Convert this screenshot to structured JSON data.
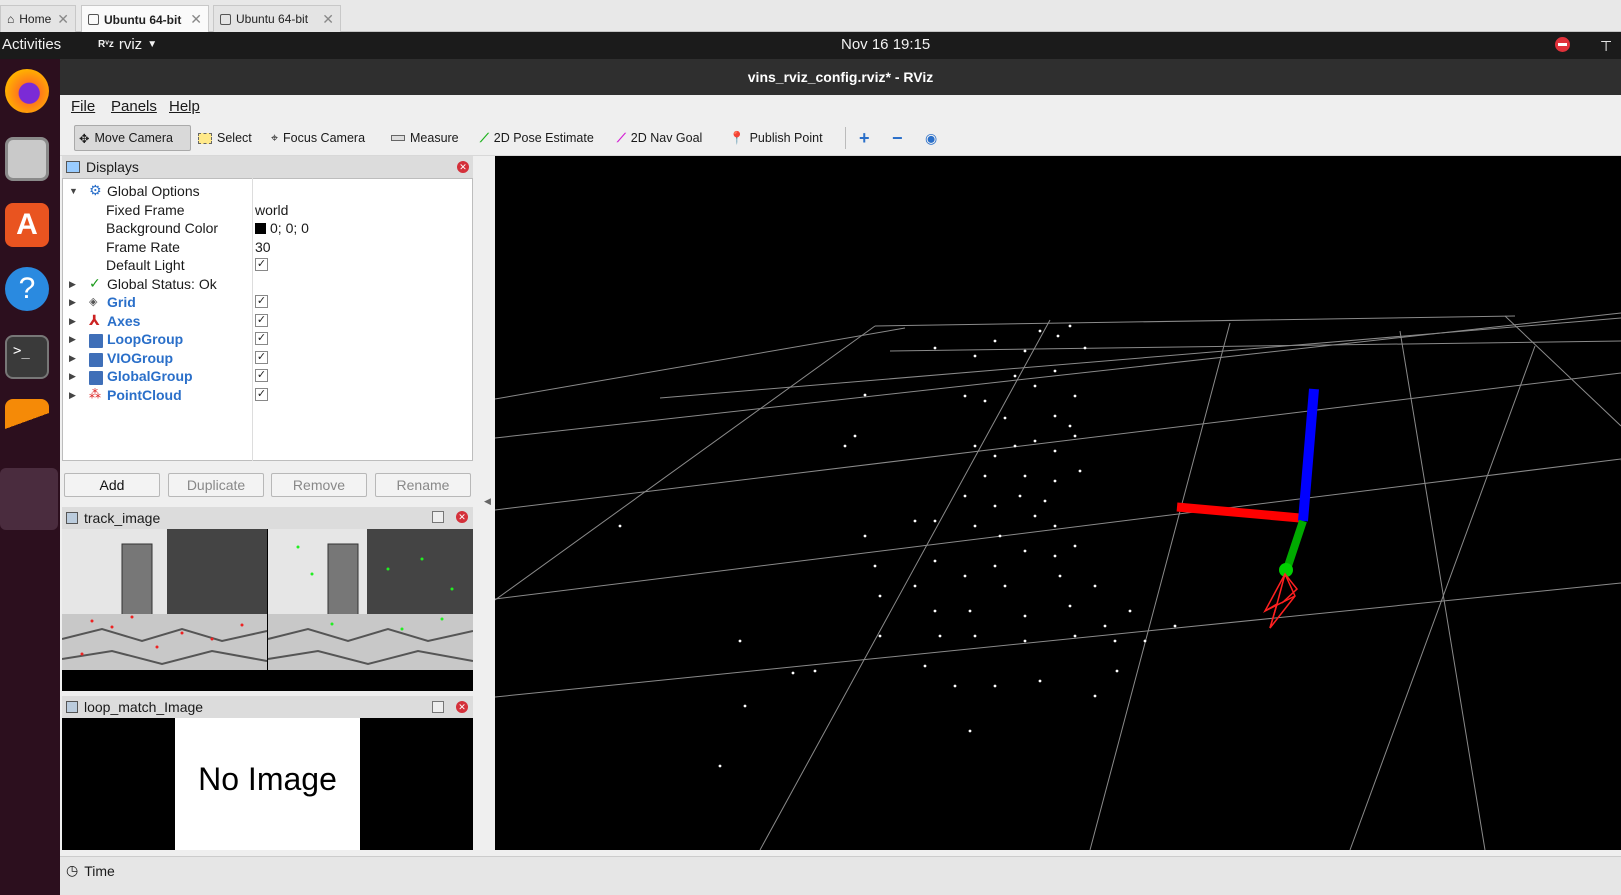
{
  "vm_tabs": [
    {
      "label": "Home"
    },
    {
      "label": "Ubuntu 64-bit"
    },
    {
      "label": "Ubuntu 64-bit"
    }
  ],
  "topbar": {
    "activities": "Activities",
    "app_name": "rviz",
    "app_logo": "Rᵛz",
    "datetime": "Nov 16  19:15"
  },
  "window": {
    "title": "vins_rviz_config.rviz* - RViz"
  },
  "menu": [
    "File",
    "Panels",
    "Help"
  ],
  "toolbar": {
    "tools": [
      "Move Camera",
      "Select",
      "Focus Camera",
      "Measure",
      "2D Pose Estimate",
      "2D Nav Goal",
      "Publish Point"
    ]
  },
  "displays": {
    "title": "Displays",
    "global_options": "Global Options",
    "props": [
      {
        "name": "Fixed Frame",
        "value": "world"
      },
      {
        "name": "Background Color",
        "value": "0; 0; 0"
      },
      {
        "name": "Frame Rate",
        "value": "30"
      },
      {
        "name": "Default Light",
        "value": "✓"
      }
    ],
    "global_status": "Global Status: Ok",
    "items": [
      {
        "name": "Grid",
        "checked": "✓"
      },
      {
        "name": "Axes",
        "checked": "✓"
      },
      {
        "name": "LoopGroup",
        "checked": "✓"
      },
      {
        "name": "VIOGroup",
        "checked": "✓"
      },
      {
        "name": "GlobalGroup",
        "checked": "✓"
      },
      {
        "name": "PointCloud",
        "checked": "✓"
      }
    ],
    "buttons": [
      "Add",
      "Duplicate",
      "Remove",
      "Rename"
    ]
  },
  "track_image": {
    "title": "track_image"
  },
  "loop_match": {
    "title": "loop_match_Image",
    "placeholder": "No Image"
  },
  "time_panel": {
    "title": "Time"
  },
  "colors": {
    "background": "#000000",
    "axis_x": "#ff0000",
    "axis_y": "#00aa00",
    "axis_z": "#0000ff",
    "accent": "#2a6fc9"
  }
}
